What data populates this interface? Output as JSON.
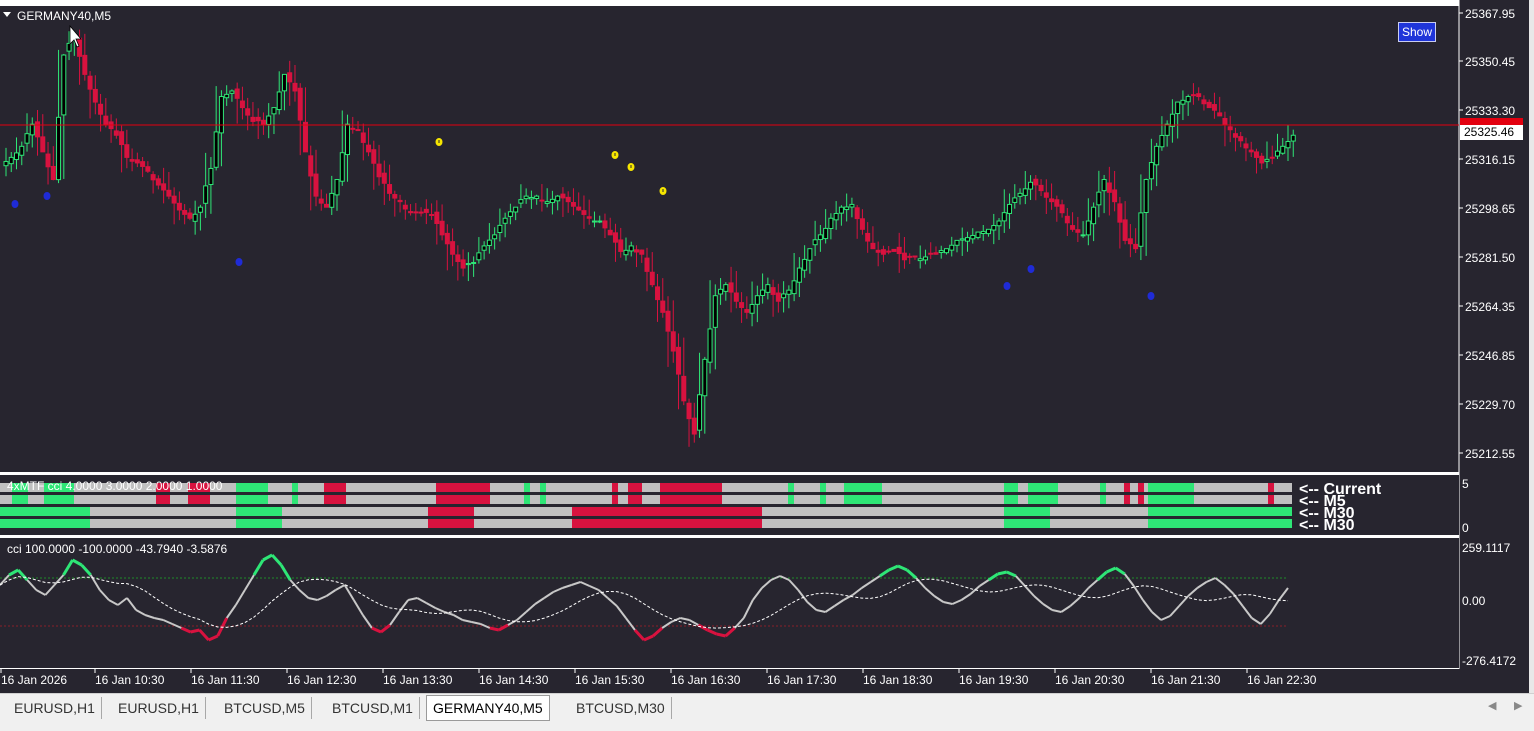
{
  "colors": {
    "background": "#27252f",
    "bull": "#2ee676",
    "bear": "#d8123f",
    "bar_gray": "#c0c0c0",
    "price_line": "#e3000f",
    "cci_line": "#c8c8c8",
    "dots_blue": "#1f2bd6",
    "dots_yellow": "#f6e600",
    "axis_text": "#ffffff"
  },
  "main_chart": {
    "symbol_label": "GERMANY40,M5",
    "price_labels": [
      "25367.95",
      "25350.45",
      "25333.30",
      "25316.15",
      "25298.65",
      "25281.50",
      "25264.35",
      "25246.85",
      "25229.70",
      "25212.55"
    ],
    "current_price": "25325.46",
    "show_button": "Show"
  },
  "mtf_panel": {
    "title": "4xMTF cci  4.0000 3.0000 2.0000 1.0000",
    "row_labels": [
      "<-- Current",
      "<-- M5",
      "<-- M30",
      "<-- M30"
    ],
    "scale_top": "5",
    "scale_bottom": "0"
  },
  "cci_panel": {
    "title": "cci  100.0000 -100.0000 -43.7940 -3.5876",
    "scale_labels": [
      "259.1117",
      "0.00",
      "-276.4172"
    ]
  },
  "time_axis": [
    "16 Jan 2026",
    "16 Jan 10:30",
    "16 Jan 11:30",
    "16 Jan 12:30",
    "16 Jan 13:30",
    "16 Jan 14:30",
    "16 Jan 15:30",
    "16 Jan 16:30",
    "16 Jan 17:30",
    "16 Jan 18:30",
    "16 Jan 19:30",
    "16 Jan 20:30",
    "16 Jan 21:30",
    "16 Jan 22:30"
  ],
  "tabs": [
    {
      "label": "EURUSD,H1",
      "active": false
    },
    {
      "label": "EURUSD,H1",
      "active": false
    },
    {
      "label": "BTCUSD,M5",
      "active": false
    },
    {
      "label": "BTCUSD,M1",
      "active": false
    },
    {
      "label": "GERMANY40,M5",
      "active": true
    },
    {
      "label": "BTCUSD,M30",
      "active": false
    }
  ],
  "chart_data": {
    "type": "candlestick",
    "price_range": [
      25205,
      25372
    ],
    "candles_close_trend": [
      25318,
      25322,
      25330,
      25320,
      25310,
      25355,
      25362,
      25348,
      25338,
      25330,
      25326,
      25318,
      25316,
      25313,
      25308,
      25304,
      25299,
      25296,
      25300,
      25314,
      25340,
      25342,
      25336,
      25331,
      25330,
      25336,
      25348,
      25342,
      25320,
      25304,
      25300,
      25310,
      25330,
      25328,
      25320,
      25311,
      25305,
      25302,
      25298,
      25298,
      25297,
      25290,
      25283,
      25278,
      25280,
      25286,
      25290,
      25296,
      25300,
      25304,
      25304,
      25302,
      25304,
      25302,
      25299,
      25296,
      25295,
      25290,
      25284,
      25286,
      25283,
      25272,
      25262,
      25248,
      25230,
      25218,
      25245,
      25268,
      25272,
      25266,
      25262,
      25268,
      25272,
      25266,
      25270,
      25278,
      25285,
      25290,
      25296,
      25300,
      25301,
      25292,
      25285,
      25283,
      25284,
      25281,
      25282,
      25282,
      25283,
      25285,
      25288,
      25289,
      25291,
      25292,
      25295,
      25301,
      25305,
      25309,
      25306,
      25302,
      25298,
      25292,
      25290,
      25300,
      25310,
      25302,
      25288,
      25285,
      25310,
      25322,
      25330,
      25338,
      25340,
      25340,
      25336,
      25333,
      25328,
      25324,
      25320,
      25316,
      25318,
      25322,
      25326
    ]
  }
}
